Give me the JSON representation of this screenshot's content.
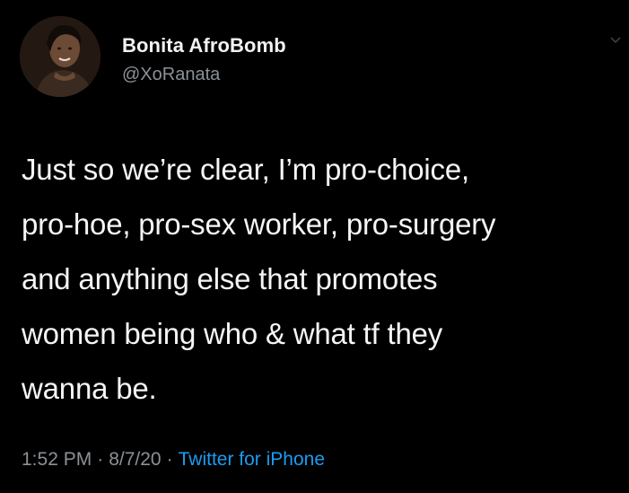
{
  "author": {
    "display_name": "Bonita AfroBomb",
    "handle": "@XoRanata"
  },
  "tweet": {
    "lines": [
      "Just so we’re clear, I’m pro-choice,",
      "pro-hoe, pro-sex worker, pro-surgery",
      "and anything else that promotes",
      "women being who & what tf they",
      "wanna be."
    ]
  },
  "meta": {
    "time": "1:52 PM",
    "date": "8/7/20",
    "separator": "·",
    "source": "Twitter for iPhone"
  },
  "colors": {
    "background": "#000000",
    "text": "#f5f5f5",
    "secondary": "#8a9197",
    "link": "#1d9bf0"
  },
  "icons": {
    "avatar": "profile-photo",
    "menu": "chevron-down-icon"
  }
}
